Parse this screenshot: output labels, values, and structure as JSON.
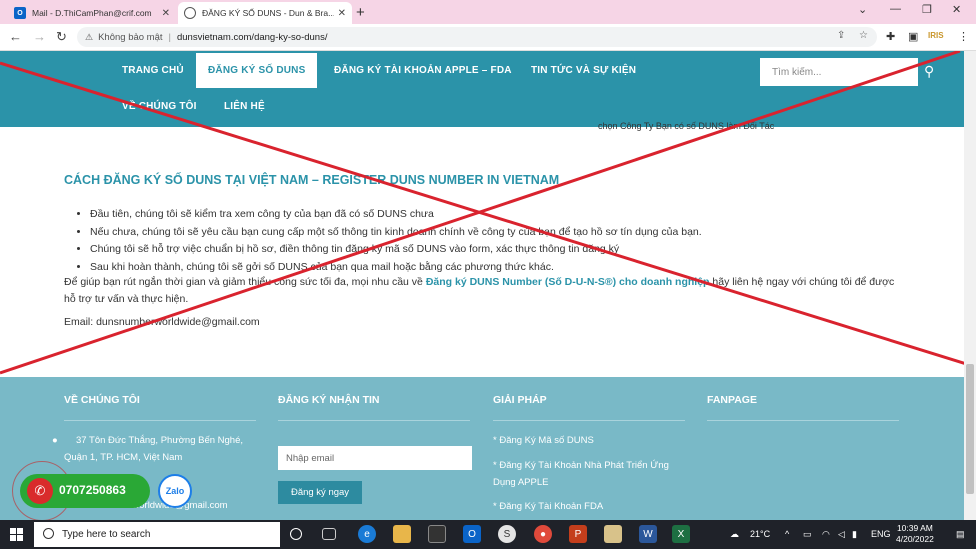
{
  "browser": {
    "tabs": [
      {
        "title": "Mail - D.ThiCamPhan@crif.com"
      },
      {
        "title": "ĐĂNG KÝ SỐ DUNS - Dun & Bra..."
      }
    ],
    "security_label": "Không bảo mật",
    "url": "dunsvietnam.com/dang-ky-so-duns/",
    "ext_label": "IRIS"
  },
  "site": {
    "nav": [
      "TRANG CHỦ",
      "ĐĂNG KÝ SỐ DUNS",
      "ĐĂNG KÝ TÀI KHOẢN APPLE – FDA",
      "TIN TỨC VÀ SỰ KIỆN",
      "VỀ CHÚNG TÔI",
      "LIÊN HỆ"
    ],
    "search_placeholder": "Tìm kiếm...",
    "overflow_text": "chọn Công Ty Bạn có số DUNS làm Đối Tác"
  },
  "content": {
    "heading": "CÁCH ĐĂNG KÝ SỐ DUNS TẠI VIỆT NAM – REGISTER DUNS NUMBER IN VIETNAM",
    "bullets": [
      "Đầu tiên, chúng tôi sẽ kiểm tra xem công ty của bạn đã có số DUNS chưa",
      "Nếu chưa, chúng tôi sẽ yêu cầu bạn cung cấp một số thông tin kinh doanh chính về công ty của bạn để tạo hồ sơ tín dụng của bạn.",
      "Chúng tôi sẽ hỗ trợ việc chuẩn bị hồ sơ, điền thông tin đăng ký mã số DUNS vào form, xác thực thông tin đăng ký",
      "Sau khi hoàn thành, chúng tôi sẽ gởi số DUNS của bạn qua mail hoặc bằng các phương thức khác."
    ],
    "para_pre": "Để giúp bạn rút ngắn thời gian và giảm thiểu công sức tối đa, mọi nhu cầu về ",
    "para_link": "Đăng ký DUNS Number (Số D-U-N-S®) cho doanh nghiệp",
    "para_post": " hãy liên hệ ngay với chúng tôi để được hỗ trợ tư vấn và thực hiện.",
    "email": "Email: dunsnumberworldwide@gmail.com"
  },
  "footer": {
    "about_title": "VỀ CHÚNG TÔI",
    "address": "37 Tôn Đức Thắng, Phường Bến Nghé, Quận 1, TP. HCM, Việt Nam",
    "email_partial": "Dunsnumberworldwide@gmail.com",
    "newsletter_title": "ĐĂNG KÝ NHẬN TIN",
    "email_placeholder": "Nhập email",
    "subscribe_label": "Đăng ký ngay",
    "solutions_title": "GIẢI PHÁP",
    "solutions": [
      "* Đăng Ký Mã số DUNS",
      "* Đăng Ký Tài Khoản Nhà Phát Triển Ứng Dụng APPLE",
      "* Đăng Ký Tài Khoản FDA"
    ],
    "fanpage_title": "FANPAGE"
  },
  "floating": {
    "phone": "0707250863",
    "zalo": "Zalo"
  },
  "taskbar": {
    "search_placeholder": "Type here to search",
    "temperature": "21°C",
    "language": "ENG",
    "time": "10:39 AM",
    "date": "4/20/2022"
  }
}
